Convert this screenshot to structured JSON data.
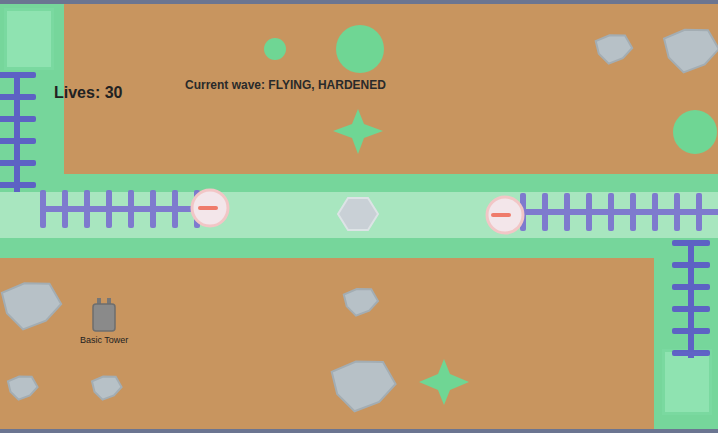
{
  "hud": {
    "lives": "Lives: 30",
    "wave": "Current wave: FLYING, HARDENED"
  },
  "towers": [
    {
      "label": "Basic Tower"
    }
  ]
}
